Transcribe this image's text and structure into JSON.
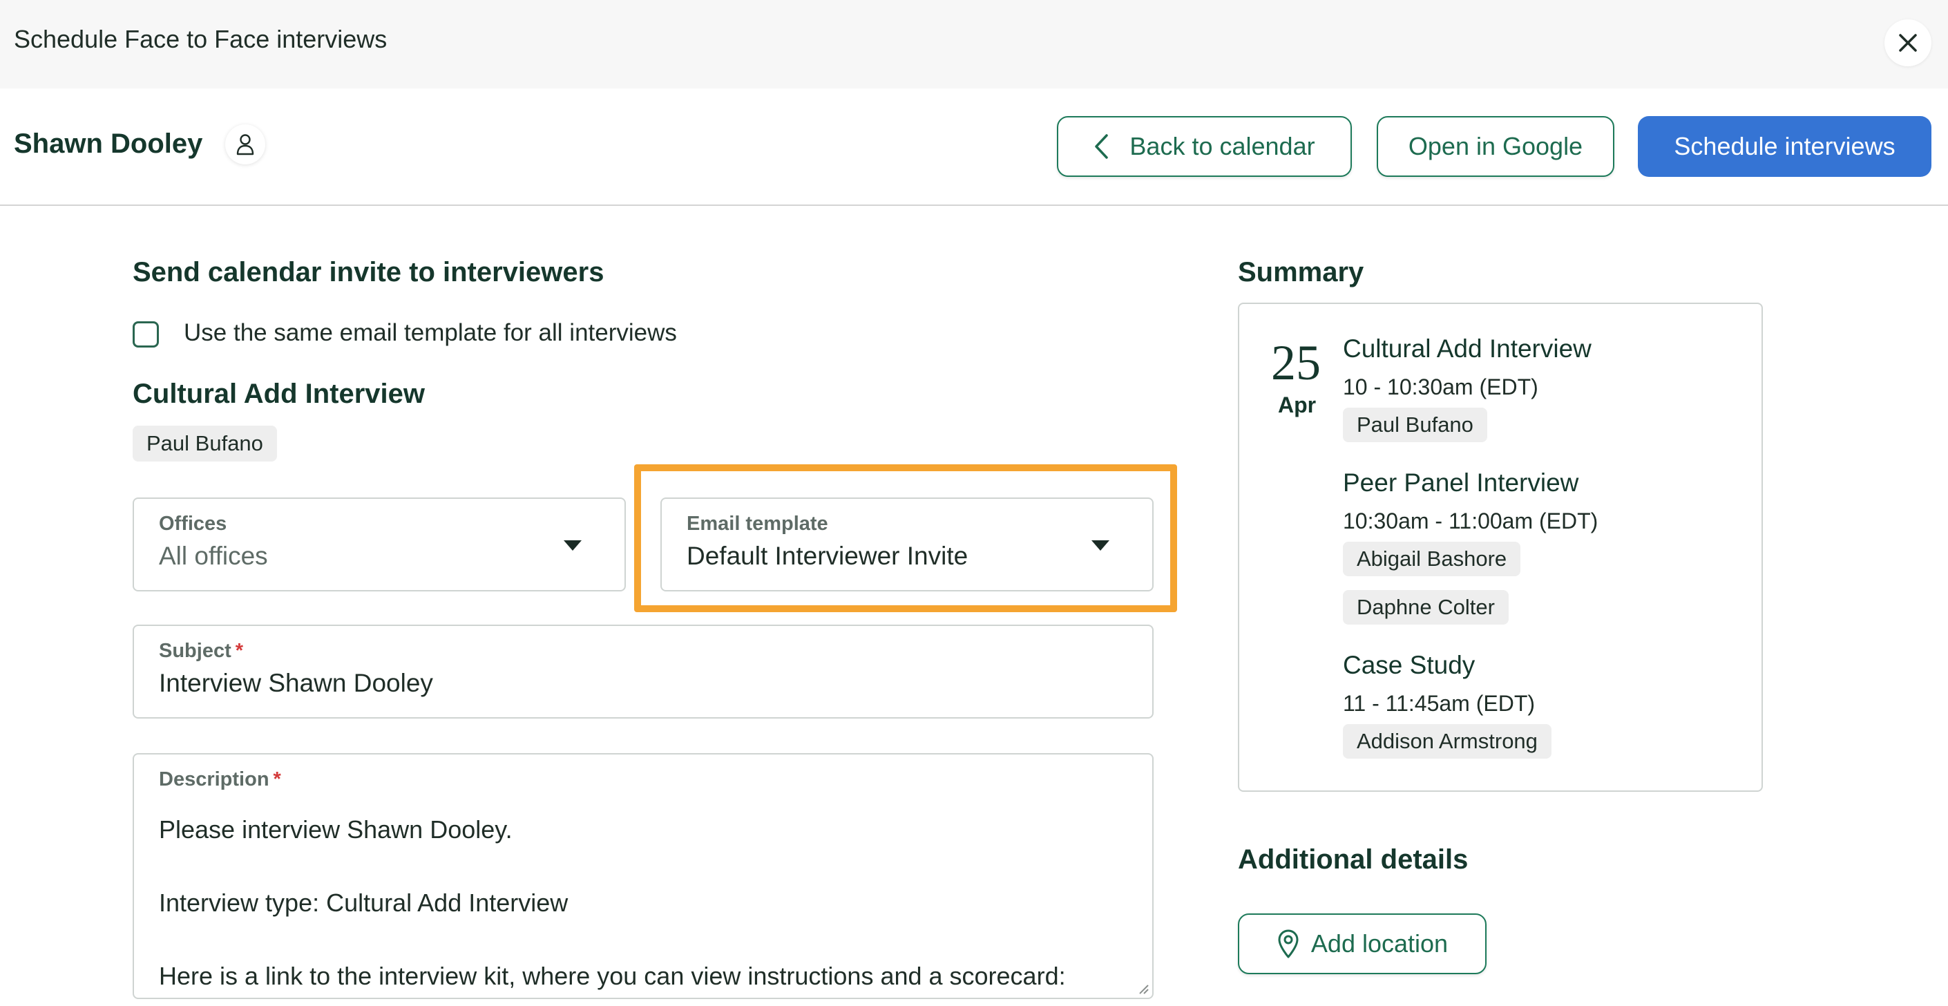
{
  "topbar": {
    "title": "Schedule Face to Face interviews"
  },
  "header": {
    "candidate_name": "Shawn Dooley",
    "back_label": "Back to calendar",
    "google_label": "Open in Google",
    "schedule_label": "Schedule interviews"
  },
  "invite": {
    "heading": "Send calendar invite to interviewers",
    "same_template_label": "Use the same email template for all interviews",
    "same_template_checked": false,
    "interview_title": "Cultural Add Interview",
    "interviewer": "Paul Bufano",
    "offices": {
      "label": "Offices",
      "value": "All offices"
    },
    "email_template": {
      "label": "Email template",
      "value": "Default Interviewer Invite"
    },
    "subject": {
      "label": "Subject",
      "required_mark": "*",
      "value": "Interview Shawn Dooley"
    },
    "description": {
      "label": "Description",
      "required_mark": "*",
      "value": "Please interview Shawn Dooley.\n\nInterview type: Cultural Add Interview\n\nHere is a link to the interview kit, where you can view instructions and a scorecard:"
    }
  },
  "summary": {
    "heading": "Summary",
    "date_day": "25",
    "date_month": "Apr",
    "interviews": [
      {
        "title": "Cultural Add Interview",
        "time": "10 - 10:30am (EDT)",
        "interviewers": [
          "Paul Bufano"
        ]
      },
      {
        "title": "Peer Panel Interview",
        "time": "10:30am - 11:00am (EDT)",
        "interviewers": [
          "Abigail Bashore",
          "Daphne Colter"
        ]
      },
      {
        "title": "Case Study",
        "time": "11 - 11:45am (EDT)",
        "interviewers": [
          "Addison Armstrong"
        ]
      }
    ]
  },
  "additional": {
    "heading": "Additional details",
    "add_location_label": "Add location"
  },
  "colors": {
    "primary": "#3574d4",
    "outline_green": "#1d7a5a",
    "highlight": "#f5a431",
    "required": "#d43a3a"
  },
  "icons": [
    "close-icon",
    "person-icon",
    "chevron-left-icon",
    "caret-down-icon",
    "location-pin-icon",
    "resize-grip-icon"
  ]
}
